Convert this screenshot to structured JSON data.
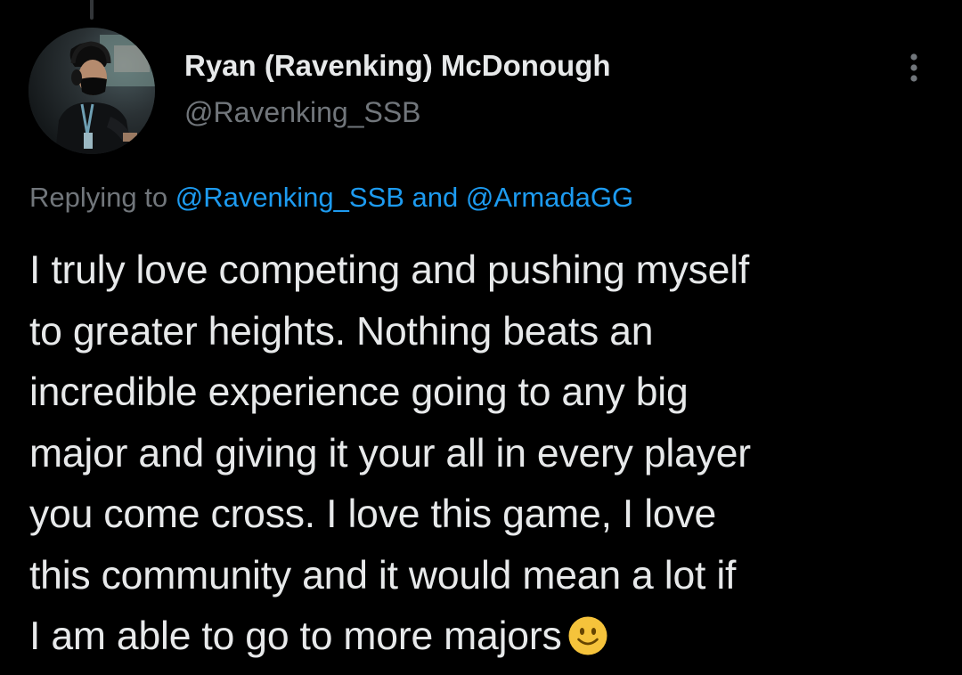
{
  "tweet": {
    "author": {
      "display_name": "Ryan (Ravenking) McDonough",
      "handle": "@Ravenking_SSB",
      "avatar_icon": "profile-photo"
    },
    "more_icon": "more-options-icon",
    "reply_context": {
      "prefix": "Replying to ",
      "mention_1": "@Ravenking_SSB",
      "joiner": " and ",
      "mention_2": "@ArmadaGG"
    },
    "text_lines": [
      "I truly love competing and pushing myself",
      "to greater heights. Nothing beats an",
      "incredible experience going to any big",
      "major and giving it your all in every player",
      "you come cross. I love this game, I love",
      "this community and it would mean a lot if",
      "I am able to go to more majors"
    ],
    "emoji": "slightly-smiling-face-icon"
  },
  "colors": {
    "background": "#000000",
    "text_primary": "#e7e9ea",
    "text_secondary": "#71767b",
    "link": "#1d9bf0",
    "emoji_fill": "#f5c33b"
  }
}
